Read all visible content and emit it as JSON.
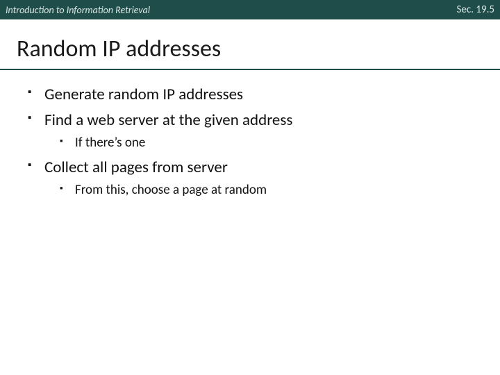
{
  "header": {
    "left": "Introduction to Information Retrieval",
    "right": "Sec. 19.5"
  },
  "title": "Random IP addresses",
  "bullets": {
    "b1": "Generate random IP addresses",
    "b2": "Find a web server at the given address",
    "b2_1": "If there’s one",
    "b3": "Collect all pages from server",
    "b3_1": "From this, choose a page at random"
  }
}
